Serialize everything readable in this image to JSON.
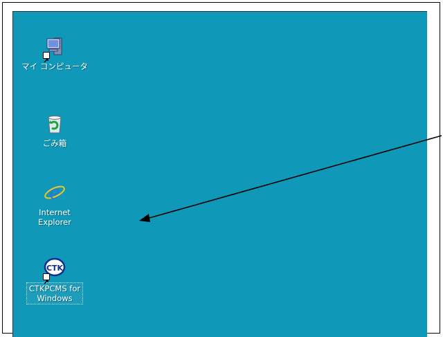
{
  "desktop": {
    "background_color": "#0f98b8",
    "icons": [
      {
        "label": "マイ コンピュータ",
        "icon": "my-computer-icon",
        "shortcut": true
      },
      {
        "label": "ごみ箱",
        "icon": "recycle-bin-icon",
        "shortcut": false
      },
      {
        "label": "Internet\nExplorer",
        "icon": "internet-explorer-icon",
        "shortcut": false
      },
      {
        "label": "CTKPCMS for\nWindows",
        "icon": "ctk-logo-icon",
        "shortcut": true,
        "selected": true
      }
    ]
  },
  "annotation": {
    "type": "arrow",
    "color": "#000000"
  }
}
